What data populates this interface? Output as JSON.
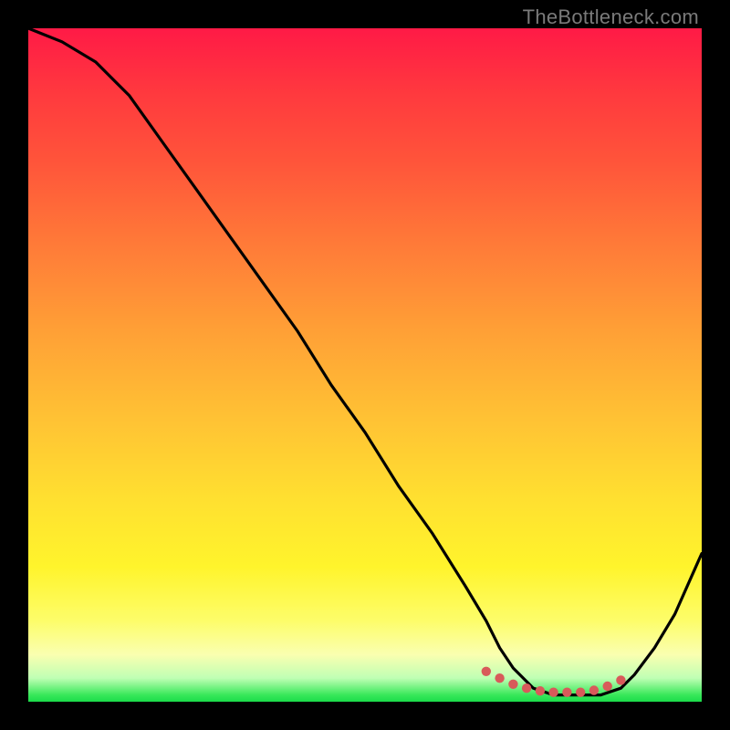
{
  "watermark": "TheBottleneck.com",
  "colors": {
    "frame": "#000000",
    "gradient_top": "#ff1a46",
    "gradient_bottom": "#1bdc4a",
    "curve": "#000000",
    "dots": "#d85a5a"
  },
  "chart_data": {
    "type": "line",
    "title": "",
    "xlabel": "",
    "ylabel": "",
    "xlim": [
      0,
      100
    ],
    "ylim": [
      0,
      100
    ],
    "grid": false,
    "series": [
      {
        "name": "bottleneck-curve",
        "x": [
          0,
          5,
          10,
          15,
          20,
          25,
          30,
          35,
          40,
          45,
          50,
          55,
          60,
          65,
          68,
          70,
          72,
          75,
          78,
          80,
          82,
          85,
          88,
          90,
          93,
          96,
          100
        ],
        "values": [
          100,
          98,
          95,
          90,
          83,
          76,
          69,
          62,
          55,
          47,
          40,
          32,
          25,
          17,
          12,
          8,
          5,
          2,
          1,
          1,
          1,
          1,
          2,
          4,
          8,
          13,
          22
        ]
      }
    ],
    "markers": {
      "name": "optimal-range-dots",
      "color": "#d85a5a",
      "x": [
        68,
        70,
        72,
        74,
        76,
        78,
        80,
        82,
        84,
        86,
        88
      ],
      "values": [
        4.5,
        3.5,
        2.6,
        2.0,
        1.6,
        1.4,
        1.4,
        1.4,
        1.7,
        2.3,
        3.2
      ]
    }
  }
}
